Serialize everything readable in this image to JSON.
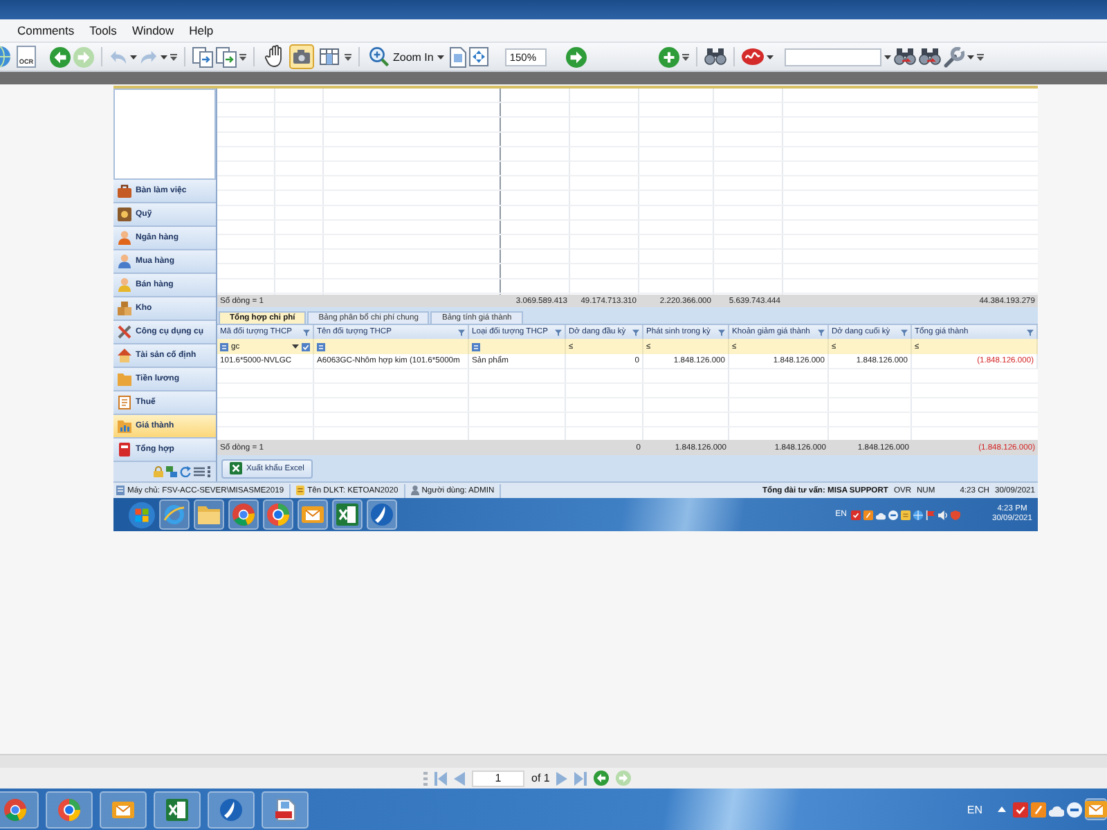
{
  "menu_bar": {
    "items": [
      "Comments",
      "Tools",
      "Window",
      "Help"
    ]
  },
  "toolbar": {
    "ocr_label": "OCR",
    "tools": [
      {
        "selected": false
      },
      {
        "selected": true
      },
      {
        "selected": false
      }
    ],
    "zoom_button": "Zoom In",
    "zoom_value": "150%"
  },
  "app": {
    "sidebar": {
      "items": [
        {
          "label": "Bàn làm việc",
          "selected": false
        },
        {
          "label": "Quỹ",
          "selected": false
        },
        {
          "label": "Ngân hàng",
          "selected": false
        },
        {
          "label": "Mua hàng",
          "selected": false
        },
        {
          "label": "Bán hàng",
          "selected": false
        },
        {
          "label": "Kho",
          "selected": false
        },
        {
          "label": "Công cụ dụng cụ",
          "selected": false
        },
        {
          "label": "Tài sản cố định",
          "selected": false
        },
        {
          "label": "Tiền lương",
          "selected": false
        },
        {
          "label": "Thuế",
          "selected": false
        },
        {
          "label": "Giá thành",
          "selected": true
        },
        {
          "label": "Tổng hợp",
          "selected": false
        }
      ]
    },
    "summary_grid": {
      "footer": {
        "label": "Số dòng = 1",
        "totals": [
          {
            "text": "3.069.589.413",
            "negative": false
          },
          {
            "text": "49.174.713.310",
            "negative": false
          },
          {
            "text": "2.220.366.000",
            "negative": false
          },
          {
            "text": "5.639.743.444",
            "negative": false
          },
          {
            "text": "44.384.193.279",
            "negative": false
          }
        ]
      }
    },
    "tabs": [
      {
        "label": "Tổng hợp chi phí",
        "selected": true
      },
      {
        "label": "Bảng phân bổ chi phí chung",
        "selected": false
      },
      {
        "label": "Bảng tính giá thành",
        "selected": false
      }
    ],
    "detail_grid": {
      "columns": [
        "Mã đối tượng THCP",
        "Tên đối tượng THCP",
        "Loại đối tượng THCP",
        "Dở dang đầu kỳ",
        "Phát sinh trong kỳ",
        "Khoản giảm giá thành",
        "Dở dang cuối kỳ",
        "Tổng giá thành"
      ],
      "filters": [
        {
          "kind": "text",
          "value": "gc"
        },
        {
          "kind": "text"
        },
        {
          "kind": "text"
        },
        {
          "kind": "number",
          "operator": "≤"
        },
        {
          "kind": "number",
          "operator": "≤"
        },
        {
          "kind": "number",
          "operator": "≤"
        },
        {
          "kind": "number",
          "operator": "≤"
        },
        {
          "kind": "number",
          "operator": "≤"
        }
      ],
      "rows": [
        {
          "cells": [
            {
              "text": "101.6*5000-NVLGC",
              "negative": false
            },
            {
              "text": "A6063GC-Nhôm hợp kim (101.6*5000m",
              "negative": false
            },
            {
              "text": "Sản phẩm",
              "negative": false
            },
            {
              "text": "0",
              "negative": false
            },
            {
              "text": "1.848.126.000",
              "negative": false
            },
            {
              "text": "1.848.126.000",
              "negative": false
            },
            {
              "text": "1.848.126.000",
              "negative": false
            },
            {
              "text": "(1.848.126.000)",
              "negative": true
            }
          ]
        }
      ],
      "footer": {
        "label": "Số dòng = 1",
        "totals": [
          {
            "text": "0",
            "negative": false
          },
          {
            "text": "1.848.126.000",
            "negative": false
          },
          {
            "text": "1.848.126.000",
            "negative": false
          },
          {
            "text": "1.848.126.000",
            "negative": false
          },
          {
            "text": "(1.848.126.000)",
            "negative": true
          }
        ]
      }
    },
    "export_button": "Xuất khẩu Excel",
    "status_bar": {
      "server": "Máy chủ: FSV-ACC-SEVER\\MISASME2019",
      "database": "Tên DLKT: KETOAN2020",
      "user": "Người dùng: ADMIN",
      "support": "Tổng đài tư vấn: MISA SUPPORT",
      "overwrite": "OVR",
      "num_lock": "NUM",
      "time": "4:23 CH",
      "date": "30/09/2021"
    },
    "taskbar": {
      "language": "EN",
      "time": "4:23 PM",
      "date": "30/09/2021"
    }
  },
  "page_navigation": {
    "page": "1",
    "total": "of 1"
  },
  "taskbar": {
    "language": "EN"
  }
}
